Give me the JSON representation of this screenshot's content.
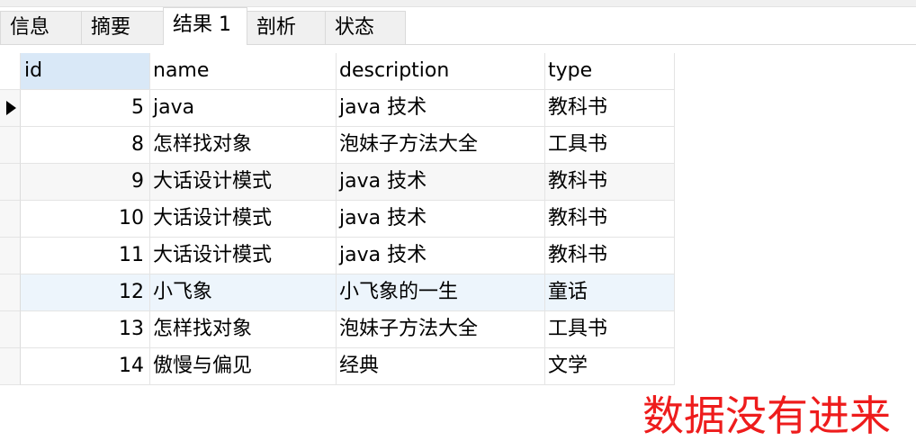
{
  "tabs": [
    {
      "label": "信息",
      "active": false
    },
    {
      "label": "摘要",
      "active": false
    },
    {
      "label": "结果 1",
      "active": true
    },
    {
      "label": "剖析",
      "active": false
    },
    {
      "label": "状态",
      "active": false
    }
  ],
  "table": {
    "columns": [
      "id",
      "name",
      "description",
      "type"
    ],
    "rows": [
      {
        "id": "5",
        "name": "java",
        "description": "java 技术",
        "type": "教科书"
      },
      {
        "id": "8",
        "name": "怎样找对象",
        "description": "泡妹子方法大全",
        "type": "工具书"
      },
      {
        "id": "9",
        "name": "大话设计模式",
        "description": "java 技术",
        "type": "教科书"
      },
      {
        "id": "10",
        "name": "大话设计模式",
        "description": "java 技术",
        "type": "教科书"
      },
      {
        "id": "11",
        "name": "大话设计模式",
        "description": "java 技术",
        "type": "教科书"
      },
      {
        "id": "12",
        "name": "小飞象",
        "description": "小飞象的一生",
        "type": "童话"
      },
      {
        "id": "13",
        "name": "怎样找对象",
        "description": "泡妹子方法大全",
        "type": "工具书"
      },
      {
        "id": "14",
        "name": "傲慢与偏见",
        "description": "经典",
        "type": "文学"
      }
    ]
  },
  "annotation": {
    "text": "数据没有进来",
    "color": "#ee1c1c"
  }
}
